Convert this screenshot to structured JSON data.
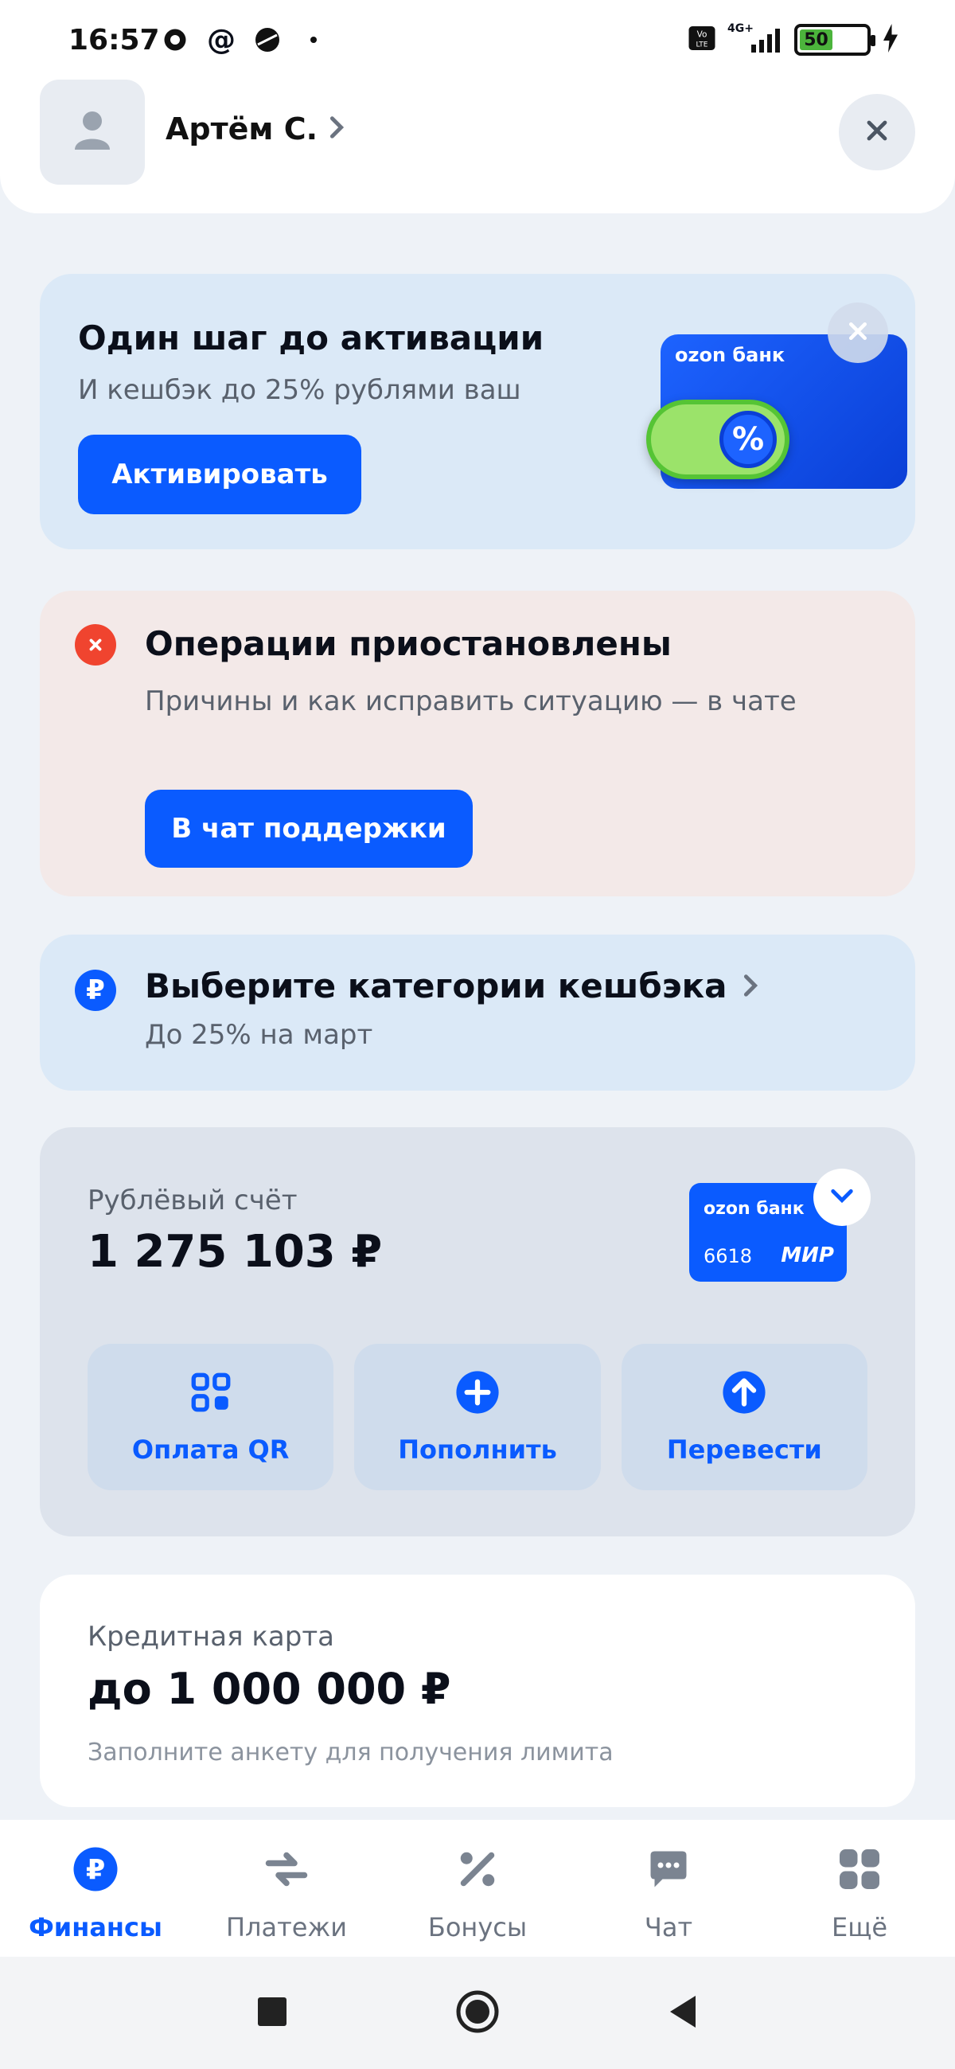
{
  "status_bar": {
    "time": "16:57",
    "battery": "50",
    "network": "4G+"
  },
  "header": {
    "user_name": "Артём С.",
    "avatar_icon": "user-icon",
    "close_icon": "close-icon"
  },
  "activation": {
    "title": "Один шаг до активации",
    "subtitle": "И кешбэк до 25% рублями ваш",
    "button": "Активировать",
    "card_brand": "ozon банк",
    "toggle_symbol": "%"
  },
  "operations": {
    "title": "Операции приостановлены",
    "subtitle": "Причины и как исправить ситуацию — в чате",
    "button": "В чат поддержки"
  },
  "cashback": {
    "title": "Выберите категории кешбэка",
    "subtitle": "До 25% на март",
    "badge": "₽"
  },
  "account": {
    "label": "Рублёвый счёт",
    "amount": "1 275 103 ₽",
    "card_brand": "ozon банк",
    "card_number": "6618",
    "card_system": "МИР",
    "actions": [
      {
        "label": "Оплата QR",
        "icon": "qr-icon"
      },
      {
        "label": "Пополнить",
        "icon": "plus-icon"
      },
      {
        "label": "Перевести",
        "icon": "arrow-up-icon"
      }
    ]
  },
  "credit": {
    "label": "Кредитная карта",
    "amount": "до 1 000 000 ₽",
    "subtitle": "Заполните анкету для получения лимита"
  },
  "bottom_nav": [
    {
      "label": "Финансы",
      "icon": "ruble-icon",
      "active": true
    },
    {
      "label": "Платежи",
      "icon": "transfer-icon",
      "active": false
    },
    {
      "label": "Бонусы",
      "icon": "percent-icon",
      "active": false
    },
    {
      "label": "Чат",
      "icon": "chat-icon",
      "active": false
    },
    {
      "label": "Ещё",
      "icon": "grid-icon",
      "active": false
    }
  ],
  "colors": {
    "accent": "#0a5bff",
    "error": "#f0442f",
    "activation_bg": "#dbe9f7",
    "operations_bg": "#f3e9e8"
  }
}
